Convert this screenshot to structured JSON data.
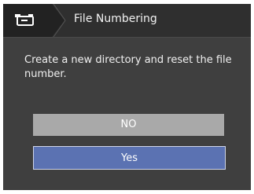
{
  "header": {
    "icon": "camera-settings-icon",
    "title": "File Numbering"
  },
  "dialog": {
    "message": "Create a new directory and reset the file number.",
    "buttons": {
      "no_label": "NO",
      "yes_label": "Yes"
    },
    "selected": "Yes"
  },
  "colors": {
    "background": "#3f3f3f",
    "header": "#2f2f2f",
    "button_default": "#a9a9a9",
    "button_selected": "#5b72b2"
  }
}
